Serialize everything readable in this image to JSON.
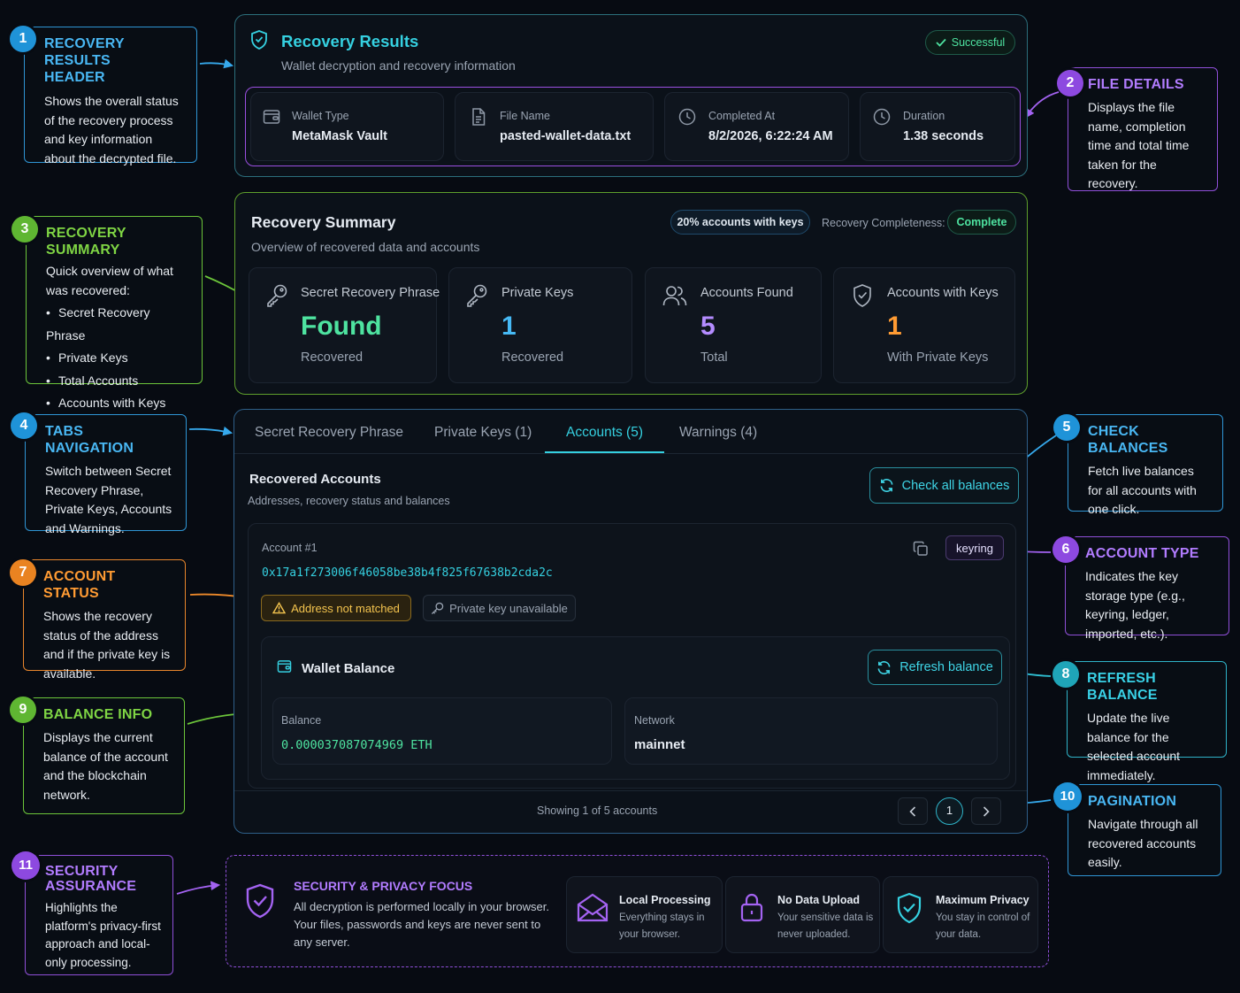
{
  "callouts": [
    {
      "num": "1",
      "title_line1": "RECOVERY RESULTS",
      "title_line2": "HEADER",
      "desc": "Shows the overall status of the recovery process and key information about the decrypted file."
    },
    {
      "num": "2",
      "title": "FILE DETAILS",
      "desc": "Displays the file name, completion time and total time taken for the recovery."
    },
    {
      "num": "3",
      "title": "RECOVERY SUMMARY",
      "desc": "Quick overview of what was recovered:",
      "bullets": [
        "Secret Recovery Phrase",
        "Private Keys",
        "Total Accounts",
        "Accounts with Keys"
      ]
    },
    {
      "num": "4",
      "title": "TABS NAVIGATION",
      "desc": "Switch between Secret Recovery Phrase, Private Keys, Accounts and Warnings."
    },
    {
      "num": "5",
      "title": "CHECK BALANCES",
      "desc": "Fetch live balances for all accounts with one click."
    },
    {
      "num": "6",
      "title": "ACCOUNT TYPE",
      "desc": "Indicates the key storage type (e.g., keyring, ledger, imported, etc.)."
    },
    {
      "num": "7",
      "title": "ACCOUNT STATUS",
      "desc": "Shows the recovery status of the address and if the private key is available."
    },
    {
      "num": "8",
      "title": "REFRESH BALANCE",
      "desc": "Update the live balance for the selected account immediately."
    },
    {
      "num": "9",
      "title": "BALANCE INFO",
      "desc": "Displays the current balance of the account and the blockchain network."
    },
    {
      "num": "10",
      "title": "PAGINATION",
      "desc": "Navigate through all recovered accounts easily."
    },
    {
      "num": "11",
      "title_line1": "SECURITY",
      "title_line2": "ASSURANCE",
      "desc": "Highlights the platform's privacy-first approach and local-only processing."
    }
  ],
  "header": {
    "title": "Recovery Results",
    "subtitle": "Wallet decryption and recovery information",
    "status": "Successful",
    "details": [
      {
        "label": "Wallet Type",
        "value": "MetaMask Vault",
        "icon": "wallet-icon"
      },
      {
        "label": "File Name",
        "value": "pasted-wallet-data.txt",
        "icon": "file-icon"
      },
      {
        "label": "Completed At",
        "value": "8/2/2026, 6:22:24 AM",
        "icon": "clock-icon"
      },
      {
        "label": "Duration",
        "value": "1.38 seconds",
        "icon": "clock-icon"
      }
    ]
  },
  "summary": {
    "title": "Recovery Summary",
    "subtitle": "Overview of recovered data and accounts",
    "accounts_with_keys_badge": "20% accounts with keys",
    "completeness_label": "Recovery Completeness:",
    "completeness_value": "Complete",
    "stats": [
      {
        "label": "Secret Recovery Phrase",
        "value": "Found",
        "sub": "Recovered",
        "icon": "key-icon",
        "color": "#4ee3a0"
      },
      {
        "label": "Private Keys",
        "value": "1",
        "sub": "Recovered",
        "icon": "key-icon",
        "color": "#46b9f5"
      },
      {
        "label": "Accounts Found",
        "value": "5",
        "sub": "Total",
        "icon": "users-icon",
        "color": "#b48cff"
      },
      {
        "label": "Accounts with Keys",
        "value": "1",
        "sub": "With Private Keys",
        "icon": "shield-check-icon",
        "color": "#ff9b33"
      }
    ]
  },
  "tabs": [
    {
      "label": "Secret Recovery Phrase"
    },
    {
      "label": "Private Keys (1)"
    },
    {
      "label": "Accounts (5)",
      "active": true
    },
    {
      "label": "Warnings (4)"
    }
  ],
  "accounts": {
    "title": "Recovered Accounts",
    "subtitle": "Addresses, recovery status and balances",
    "check_all_label": "Check all balances",
    "account_label": "Account #1",
    "address": "0x17a1f273006f46058be38b4f825f67638b2cda2c",
    "type_badge": "keyring",
    "status_badge": "Address not matched",
    "key_badge": "Private key unavailable",
    "balance_section_title": "Wallet Balance",
    "refresh_label": "Refresh balance",
    "balance_label": "Balance",
    "balance_value": "0.000037087074969 ETH",
    "network_label": "Network",
    "network_value": "mainnet",
    "showing_text": "Showing 1 of 5 accounts",
    "current_page": "1"
  },
  "security": {
    "title": "SECURITY & PRIVACY FOCUS",
    "text": "All decryption is performed locally in your browser. Your files, passwords and keys are never sent to any server.",
    "features": [
      {
        "title": "Local Processing",
        "line1": "Everything stays in",
        "line2": "your browser.",
        "icon": "envelope-icon"
      },
      {
        "title": "No Data Upload",
        "line1": "Your sensitive data is",
        "line2": "never uploaded.",
        "icon": "lock-icon"
      },
      {
        "title": "Maximum Privacy",
        "line1": "You stay in control of",
        "line2": "your data.",
        "icon": "shield-check-icon"
      }
    ]
  },
  "colors": {
    "teal": "#35d0e0",
    "purple": "#a463f2",
    "green": "#6cc53a",
    "blue": "#2f95d4",
    "orange": "#e8862c"
  }
}
